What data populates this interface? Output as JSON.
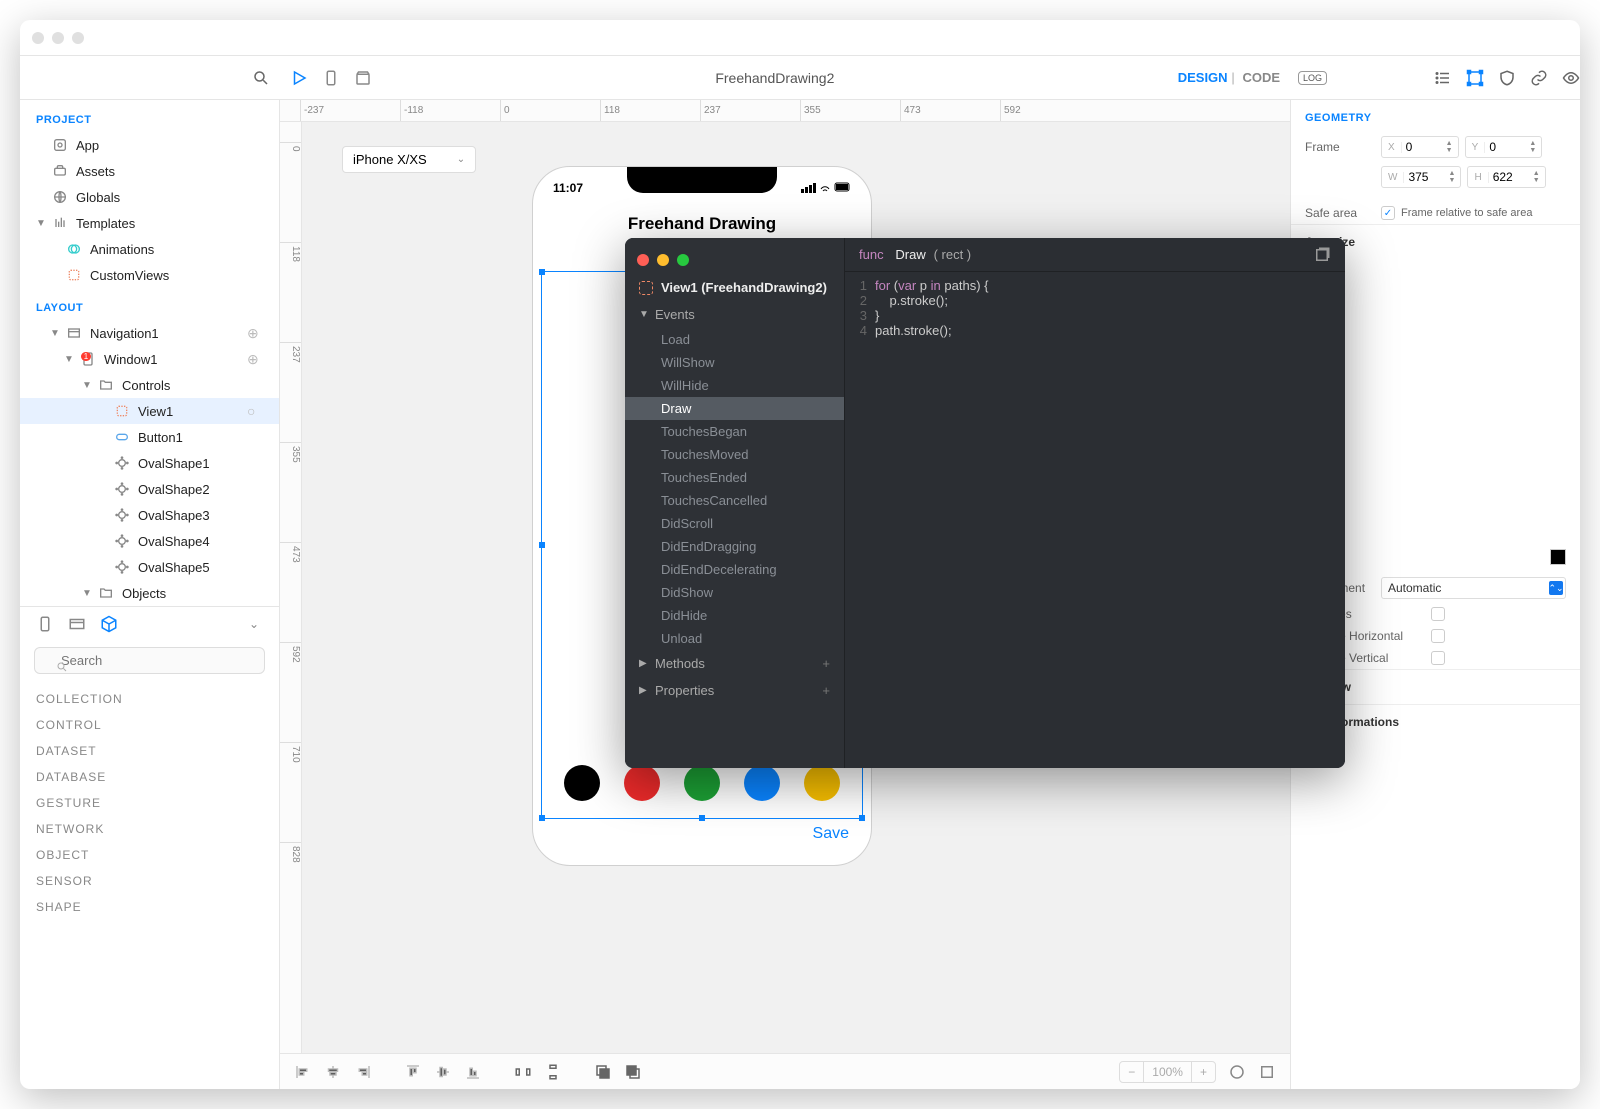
{
  "title": "FreehandDrawing2",
  "modes": {
    "design": "DESIGN",
    "code": "CODE"
  },
  "log_label": "LOG",
  "project_header": "PROJECT",
  "layout_header": "LAYOUT",
  "project_items": [
    {
      "label": "App",
      "icon": "app"
    },
    {
      "label": "Assets",
      "icon": "assets"
    },
    {
      "label": "Globals",
      "icon": "globals"
    },
    {
      "label": "Templates",
      "icon": "templates",
      "expandable": true,
      "expanded": true
    },
    {
      "label": "Animations",
      "icon": "animations",
      "indent": 1
    },
    {
      "label": "CustomViews",
      "icon": "customviews",
      "indent": 1
    }
  ],
  "layout_tree": [
    {
      "label": "Navigation1",
      "icon": "nav",
      "chev": "▼",
      "action": "+"
    },
    {
      "label": "Window1",
      "icon": "window",
      "chev": "▼",
      "indent": 1,
      "badge": "1",
      "action": "+"
    },
    {
      "label": "Controls",
      "icon": "folder",
      "chev": "▼",
      "indent": 2
    },
    {
      "label": "View1",
      "icon": "view",
      "indent": 3,
      "selected": true,
      "action": "○"
    },
    {
      "label": "Button1",
      "icon": "button",
      "indent": 3
    },
    {
      "label": "OvalShape1",
      "icon": "oval",
      "indent": 3
    },
    {
      "label": "OvalShape2",
      "icon": "oval",
      "indent": 3
    },
    {
      "label": "OvalShape3",
      "icon": "oval",
      "indent": 3
    },
    {
      "label": "OvalShape4",
      "icon": "oval",
      "indent": 3
    },
    {
      "label": "OvalShape5",
      "icon": "oval",
      "indent": 3
    },
    {
      "label": "Objects",
      "icon": "folder",
      "chev": "▼",
      "indent": 2
    }
  ],
  "search_placeholder": "Search",
  "categories": [
    "COLLECTION",
    "CONTROL",
    "DATASET",
    "DATABASE",
    "GESTURE",
    "NETWORK",
    "OBJECT",
    "SENSOR",
    "SHAPE"
  ],
  "ruler_h": [
    "-237",
    "-118",
    "0",
    "118",
    "237",
    "355",
    "473",
    "592"
  ],
  "ruler_v": [
    "0",
    "118",
    "237",
    "355",
    "473",
    "592",
    "710",
    "828"
  ],
  "device_label": "iPhone X/XS",
  "phone": {
    "time": "11:07",
    "title": "Freehand Drawing",
    "save": "Save",
    "colors": [
      "#000000",
      "#ea2a2a",
      "#1ca035",
      "#0a84ff",
      "#f6be00"
    ]
  },
  "zoom": "100%",
  "inspector": {
    "header": "GEOMETRY",
    "frame_label": "Frame",
    "x": "0",
    "y": "0",
    "w": "375",
    "h": "622",
    "safearea_label": "Safe area",
    "safearea_text": "Frame relative to safe area",
    "autosize": "Autosize",
    "adjustment_label": "Adjustment",
    "adjustment_value": "Automatic",
    "bounces": "Bounces",
    "bounce_h": "Bounce Horizontal",
    "bounce_v": "Bounce Vertical",
    "shadow": "Shadow",
    "transforms": "Transformations"
  },
  "code": {
    "view_label": "View1 (FreehandDrawing2)",
    "sections": {
      "events": "Events",
      "methods": "Methods",
      "properties": "Properties"
    },
    "events": [
      "Load",
      "WillShow",
      "WillHide",
      "Draw",
      "TouchesBegan",
      "TouchesMoved",
      "TouchesEnded",
      "TouchesCancelled",
      "DidScroll",
      "DidEndDragging",
      "DidEndDecelerating",
      "DidShow",
      "DidHide",
      "Unload"
    ],
    "active_event": "Draw",
    "sig_func": "func",
    "sig_name": "Draw",
    "sig_params": "( rect  )",
    "lines": [
      {
        "n": "1",
        "html": "for (var p in paths) {"
      },
      {
        "n": "2",
        "html": "    p.stroke();"
      },
      {
        "n": "3",
        "html": "}"
      },
      {
        "n": "4",
        "html": "path.stroke();"
      }
    ]
  }
}
